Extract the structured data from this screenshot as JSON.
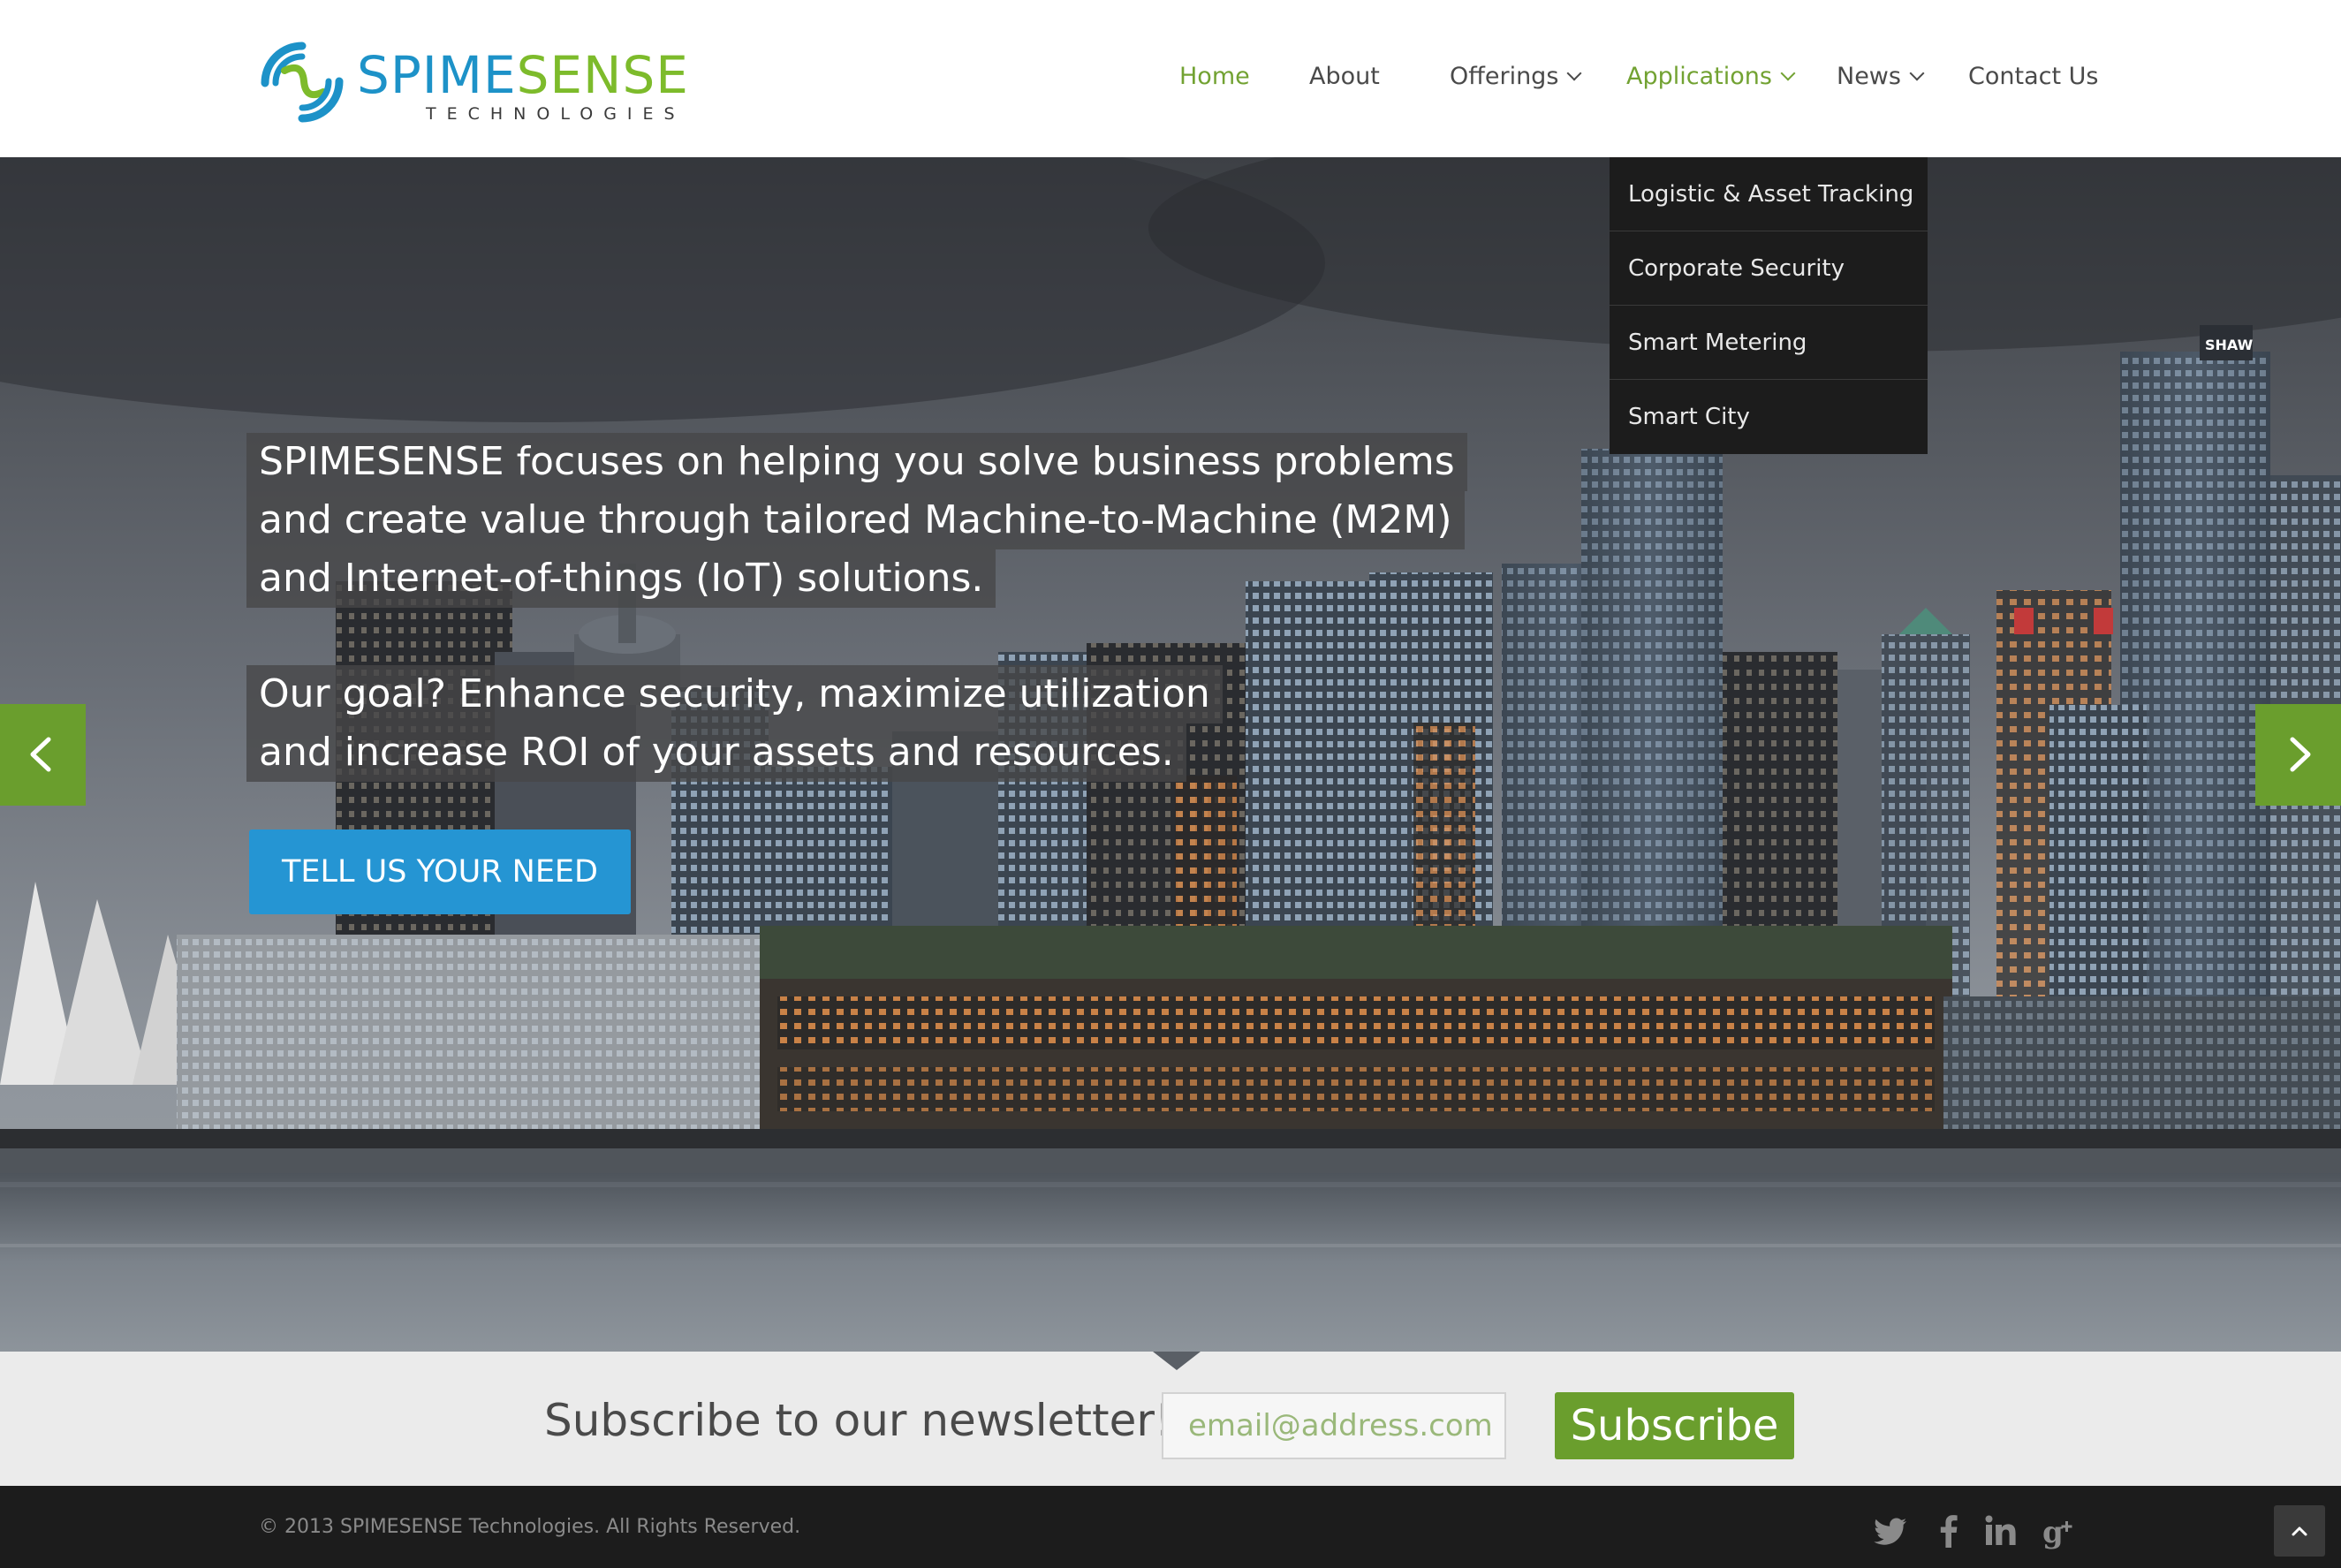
{
  "brand": {
    "name_part1": "SPIME",
    "name_part2": "SENSE",
    "subtitle": "TECHNOLOGIES",
    "color_blue": "#1d92c8",
    "color_green": "#7dbb2b"
  },
  "nav": {
    "items": [
      {
        "label": "Home",
        "active": true,
        "dropdown": false
      },
      {
        "label": "About",
        "active": false,
        "dropdown": false
      },
      {
        "label": "Offerings",
        "active": false,
        "dropdown": true
      },
      {
        "label": "Applications",
        "active": true,
        "dropdown": true
      },
      {
        "label": "News",
        "active": false,
        "dropdown": true
      },
      {
        "label": "Contact Us",
        "active": false,
        "dropdown": false
      }
    ],
    "active_color": "#72a232"
  },
  "applications_menu": {
    "items": [
      {
        "label": "Logistic & Asset Tracking"
      },
      {
        "label": "Corporate Security"
      },
      {
        "label": "Smart Metering"
      },
      {
        "label": "Smart City"
      }
    ]
  },
  "hero": {
    "paragraph1": [
      "SPIMESENSE focuses on helping you solve business problems",
      "and create value through tailored Machine-to-Machine (M2M)",
      "and Internet-of-things (IoT) solutions."
    ],
    "paragraph2": [
      "Our goal? Enhance security, maximize utilization",
      "and increase ROI of your assets and resources."
    ],
    "cta_label": "TELL US YOUR NEED",
    "cta_color": "#2595d3",
    "prev_icon": "chevron-left-icon",
    "next_icon": "chevron-right-icon",
    "arrow_color": "#6a9e2d",
    "building_sign": "SHAW"
  },
  "newsletter": {
    "label": "Subscribe to our newsletter!",
    "email_placeholder": "email@address.com",
    "button_label": "Subscribe"
  },
  "footer": {
    "copyright": "© 2013 SPIMESENSE Technologies. All Rights Reserved.",
    "social_icons": [
      "twitter-icon",
      "facebook-icon",
      "linkedin-icon",
      "google-plus-icon"
    ],
    "to_top_icon": "chevron-up-icon"
  }
}
